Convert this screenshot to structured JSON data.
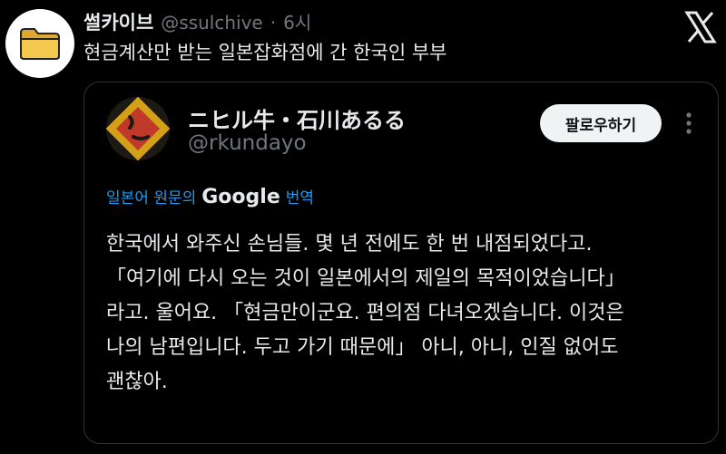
{
  "tweet": {
    "author_name": "썰카이브",
    "author_handle": "@ssulchive",
    "separator": "·",
    "time": "6시",
    "text": "현금계산만 받는 일본잡화점에 간 한국인 부부",
    "avatar_icon": "folder-icon"
  },
  "quote": {
    "author_name": "ニヒル牛・石川あるる",
    "author_handle": "@rkundayo",
    "follow_label": "팔로우하기",
    "translate_prefix": "일본어 원문의",
    "translate_brand": "Google",
    "translate_suffix": "번역",
    "body_lines": [
      "한국에서 와주신 손님들. 몇 년 전에도 한 번 내점되었다고.",
      "「여기에 다시 오는 것이 일본에서의 제일의 목적이었습니다」",
      "라고. 울어요. 「현금만이군요. 편의점 다녀오겠습니다. 이것은",
      "나의 남편입니다. 두고 가기 때문에」 아니, 아니, 인질 없어도",
      "괜찮아."
    ]
  },
  "colors": {
    "background": "#000000",
    "text": "#e7e9ea",
    "muted": "#71767b",
    "link": "#1d9bf0",
    "border": "#2f3336",
    "folder": "#f2c94c"
  }
}
